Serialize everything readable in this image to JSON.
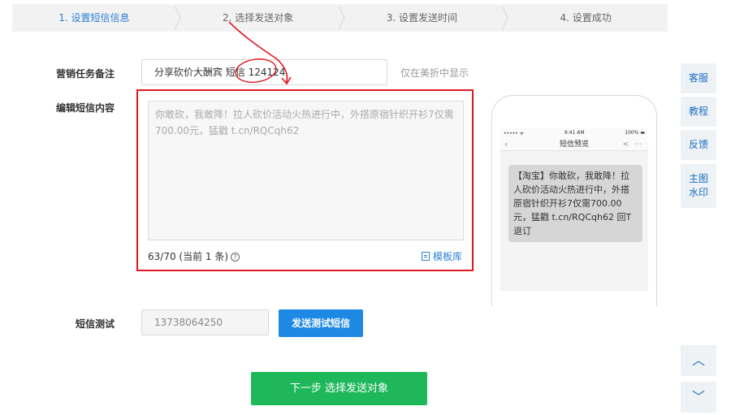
{
  "steps": [
    {
      "label": "1. 设置短信信息"
    },
    {
      "label": "2. 选择发送对象"
    },
    {
      "label": "3. 设置发送时间"
    },
    {
      "label": "4. 设置成功"
    }
  ],
  "form": {
    "remark_label": "营销任务备注",
    "remark_value": "分享砍价大酬宾 短信 124124",
    "remark_hint": "仅在美折中显示",
    "content_label": "编辑短信内容",
    "content_text": "你敢砍，我敢降！拉人砍价活动火热进行中，外搭原宿针织开衫7仅需700.00元，猛戳 t.cn/RQCqh62",
    "counter": "63/70 (当前 1 条)",
    "help_icon": "?",
    "template_link": "模板库",
    "test_label": "短信测试",
    "test_phone": "13738064250",
    "test_button": "发送测试短信",
    "next_button": "下一步 选择发送对象"
  },
  "phone": {
    "carrier": "•••••  ᯤ",
    "time": "9:41 AM",
    "battery": "100% ▬",
    "title": "短信预览",
    "back": "‹",
    "actions": "< ⋯",
    "message": "【淘宝】你敢砍，我敢降！拉人砍价活动火热进行中，外搭原宿针织开衫7仅需700.00元，猛戳 t.cn/RQCqh62 回T退订"
  },
  "side": {
    "service": "客服",
    "tutorial": "教程",
    "feedback": "反馈",
    "watermark": "主图水印",
    "up": "︿",
    "down": "﹀"
  },
  "colors": {
    "accent": "#2a7fd4",
    "highlight": "#e0191f",
    "next": "#1eb85a",
    "test_button": "#1e88e5"
  }
}
